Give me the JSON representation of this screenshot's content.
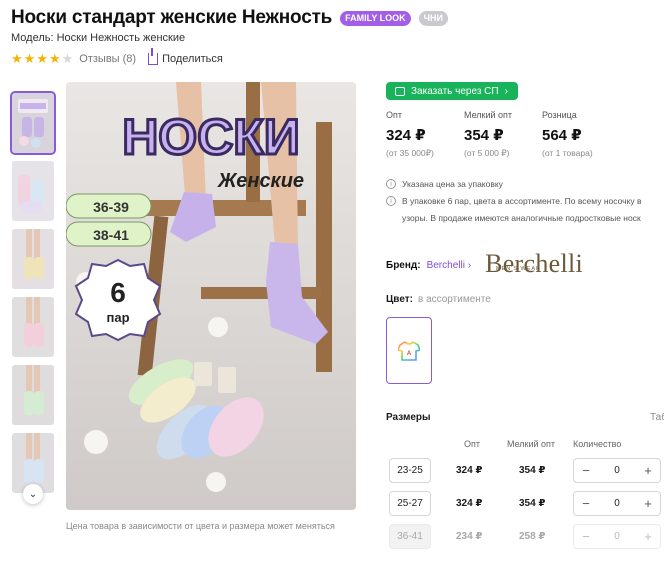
{
  "product": {
    "title": "Носки стандарт женские Нежность",
    "badges": [
      "FAMILY LOOK",
      "ЧНИ"
    ],
    "model": "Модель: Носки Нежность женские",
    "rating": 4,
    "rating_max": 5,
    "reviews": "Отзывы (8)",
    "share": "Поделиться"
  },
  "gallery": {
    "thumb_count": 6,
    "caption": "Цена товара в зависимости от цвета и размера может меняться",
    "image_text": {
      "headline": "НОСКИ",
      "subhead": "Женские",
      "sizes": [
        "36-39",
        "38-41"
      ],
      "pack_count": "6",
      "pack_unit": "пар"
    }
  },
  "purchase": {
    "sp_button": "Заказать через СП",
    "prices": [
      {
        "label": "Опт",
        "value": "324 ₽",
        "note": "(от 35 000₽)"
      },
      {
        "label": "Мелкий опт",
        "value": "354 ₽",
        "note": "(от 5 000 ₽)"
      },
      {
        "label": "Розница",
        "value": "564 ₽",
        "note": "(от 1 товара)"
      }
    ],
    "notes": [
      "Указана цена за упаковку",
      "В упаковке 6 пар, цвета в ассортименте. По всему носочку в",
      "узоры. В продаже имеются аналогичные подростковые носк"
    ]
  },
  "brand": {
    "label": "Бренд:",
    "name": "Berchelli",
    "logo": "Berchelli",
    "logo_sub": "MEN'S WEAR"
  },
  "color": {
    "label": "Цвет:",
    "value": "в ассортименте"
  },
  "sizes": {
    "heading": "Размеры",
    "table_link": "Таб",
    "columns": [
      "Опт",
      "Мелкий опт",
      "Количество"
    ],
    "rows": [
      {
        "size": "23-25",
        "opt": "324 ₽",
        "small": "354 ₽",
        "qty": "0",
        "available": true
      },
      {
        "size": "25-27",
        "opt": "324 ₽",
        "small": "354 ₽",
        "qty": "0",
        "available": true
      },
      {
        "size": "36-41",
        "opt": "234 ₽",
        "small": "258 ₽",
        "qty": "0",
        "available": false
      }
    ]
  },
  "colors": {
    "accent": "#7b4be0",
    "green": "#18b35a",
    "star": "#f5b400"
  }
}
